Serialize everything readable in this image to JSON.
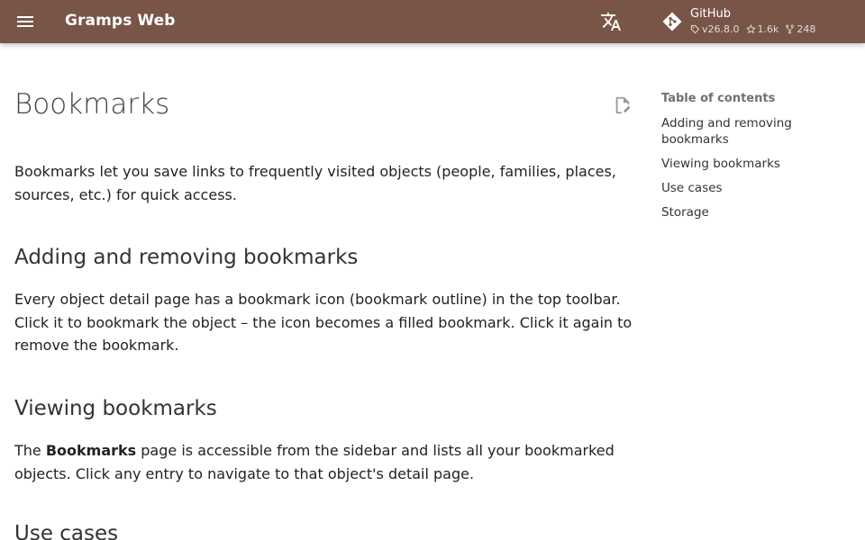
{
  "header": {
    "site_title": "Gramps Web",
    "background_color": "#795548",
    "menu_icon": "hamburger-menu-icon",
    "language_icon": "translate-icon",
    "repo": {
      "name": "GitHub",
      "icon": "git-diamond-icon",
      "version": "v26.8.0",
      "stars": "1.6k",
      "forks": "248"
    }
  },
  "page": {
    "title": "Bookmarks",
    "edit_icon": "edit-page-icon",
    "intro": "Bookmarks let you save links to frequently visited objects (people, families, places, sources, etc.) for quick access.",
    "sections": [
      {
        "heading": "Adding and removing bookmarks",
        "text": "Every object detail page has a bookmark icon (bookmark outline) in the top toolbar. Click it to bookmark the object – the icon becomes a filled bookmark. Click it again to remove the bookmark."
      },
      {
        "heading": "Viewing bookmarks",
        "text_before": "The ",
        "text_bold": "Bookmarks",
        "text_after": " page is accessible from the sidebar and lists all your bookmarked objects. Click any entry to navigate to that object's detail page."
      },
      {
        "heading": "Use cases"
      }
    ]
  },
  "toc": {
    "title": "Table of contents",
    "items": [
      "Adding and removing bookmarks",
      "Viewing bookmarks",
      "Use cases",
      "Storage"
    ]
  }
}
